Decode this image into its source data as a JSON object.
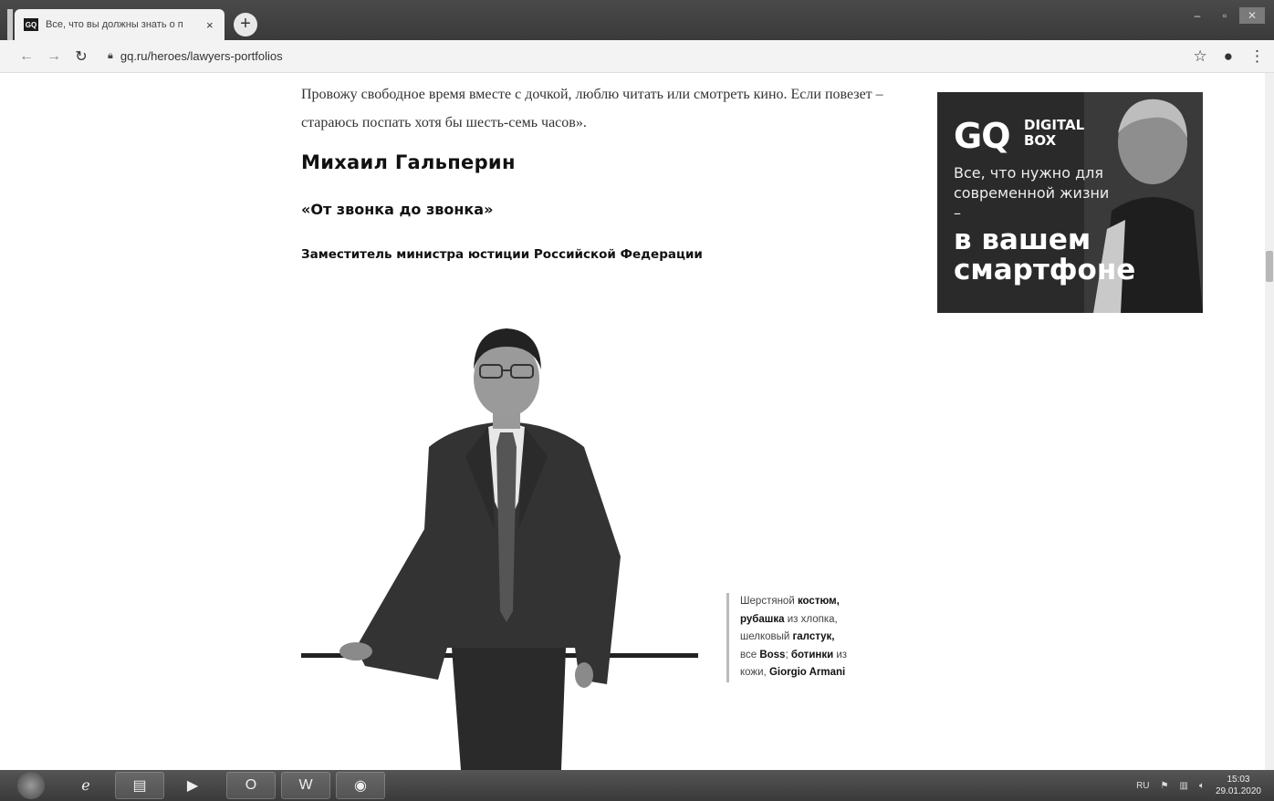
{
  "browser": {
    "tab_favicon": "GQ",
    "tab_title": "Все, что вы должны знать о п",
    "tab_close": "×",
    "new_tab": "+",
    "url": "gq.ru/heroes/lawyers-portfolios",
    "icons": [
      "back-icon",
      "forward-icon",
      "reload-icon",
      "lock-icon",
      "star-icon",
      "account-icon",
      "menu-icon"
    ]
  },
  "article": {
    "paragraph": "Провожу свободное время вместе с дочкой, люблю читать или смотреть кино. Если повезет – стараюсь поспать хотя бы шесть-семь часов».",
    "name": "Михаил Гальперин",
    "quote": "«От звонка до звонка»",
    "position": "Заместитель министра юстиции Российской Федерации",
    "caption": {
      "p1": "Шерстяной ",
      "b1": "костюм,",
      "b2": "рубашка",
      "p2": " из хлопка,",
      "p3": "шелковый ",
      "b3": "галстук,",
      "p4": "все ",
      "b4": "Boss",
      "p5": "; ",
      "b5": "ботинки",
      "p6": " из",
      "p7": "кожи, ",
      "b6": "Giorgio Armani"
    }
  },
  "ad": {
    "logo": "GQ",
    "logo_line1": "DIGITAL",
    "logo_line2": "BOX",
    "tagline": "Все, что нужно для современной жизни –",
    "headline": "в вашем смартфоне"
  },
  "taskbar": {
    "outlook_label": "O",
    "word_label": "W",
    "lang": "RU",
    "time": "15:03",
    "date": "29.01.2020"
  }
}
